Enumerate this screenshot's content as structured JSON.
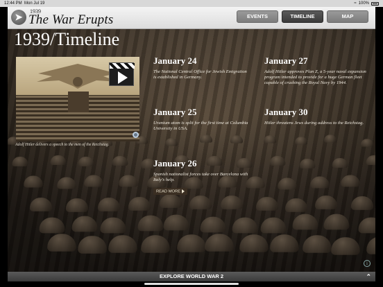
{
  "status_bar": {
    "time": "12:44 PM",
    "date": "Mon Jul 19",
    "battery": "100%"
  },
  "header": {
    "year": "1939",
    "title": "The War Erupts",
    "back_icon": "back-arrow-icon",
    "nav": [
      {
        "label": "EVENTS",
        "active": false
      },
      {
        "label": "TIMELINE",
        "active": true
      },
      {
        "label": "MAP",
        "active": false
      }
    ]
  },
  "main": {
    "page_title": "1939/Timeline",
    "video": {
      "icon": "video-play-icon",
      "caption": "Adolf Hitler delivers a speech to the men of the Reichstag."
    },
    "events": [
      {
        "date": "January 24",
        "description": "The National Central Office for Jewish Emigration is established in Germany."
      },
      {
        "date": "January 27",
        "description": "Adolf Hitler approves Plan Z, a 5-year naval expansion program intended to provide for a huge German fleet capable of crushing the Royal Navy by 1944."
      },
      {
        "date": "January 25",
        "description": "Uranium atom is split for the first time at Columbia University in USA."
      },
      {
        "date": "January 30",
        "description": "Hitler threatens Jews during address to the Reichstag."
      },
      {
        "date": "January 26",
        "description": "Spanish nationalist forces take over Barcelona with Italy's help.",
        "read_more": "READ MORE"
      }
    ]
  },
  "bottom_bar": {
    "label": "EXPLORE WORLD WAR 2",
    "icon": "chevron-up-icon"
  }
}
